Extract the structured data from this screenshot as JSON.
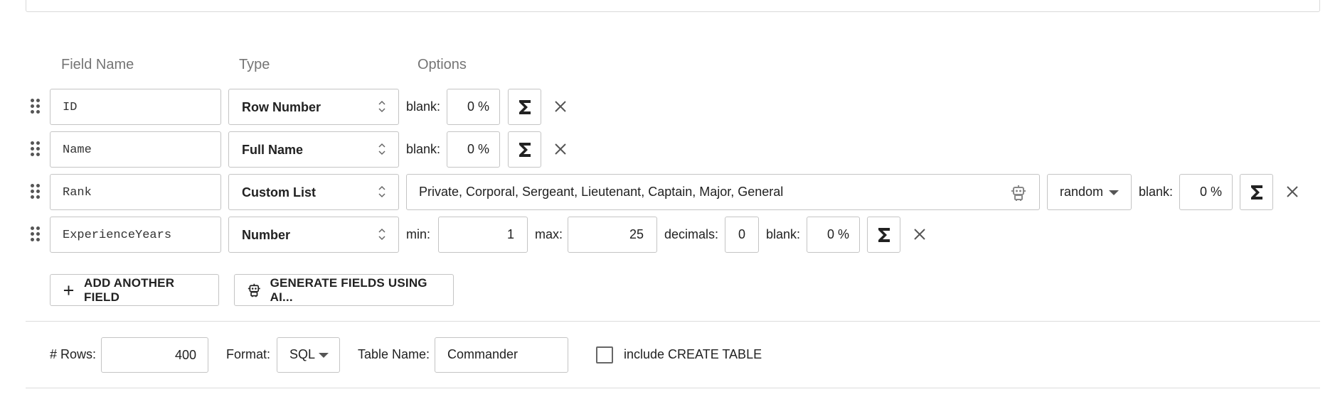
{
  "headers": {
    "field_name": "Field Name",
    "type": "Type",
    "options": "Options"
  },
  "rows": [
    {
      "name": "ID",
      "type": "Row Number",
      "blank_label": "blank:",
      "blank_value": "0 %"
    },
    {
      "name": "Name",
      "type": "Full Name",
      "blank_label": "blank:",
      "blank_value": "0 %"
    },
    {
      "name": "Rank",
      "type": "Custom List",
      "values": "Private, Corporal, Sergeant, Lieutenant, Captain, Major, General",
      "order": "random",
      "blank_label": "blank:",
      "blank_value": "0 %"
    },
    {
      "name": "ExperienceYears",
      "type": "Number",
      "min_label": "min:",
      "min": "1",
      "max_label": "max:",
      "max": "25",
      "decimals_label": "decimals:",
      "decimals": "0",
      "blank_label": "blank:",
      "blank_value": "0 %"
    }
  ],
  "actions": {
    "add_field": "ADD ANOTHER FIELD",
    "generate_ai": "GENERATE FIELDS USING AI..."
  },
  "footer": {
    "rows_label": "# Rows:",
    "rows_value": "400",
    "format_label": "Format:",
    "format_value": "SQL",
    "table_name_label": "Table Name:",
    "table_name_value": "Commander",
    "create_table_label": "include CREATE TABLE"
  },
  "icons": {
    "drag": "drag-handle-icon",
    "sigma": "sigma-icon",
    "close": "close-icon",
    "robot": "robot-icon",
    "plus": "plus-icon",
    "chevron": "chevron-updown-icon",
    "caret": "caret-down-icon"
  }
}
